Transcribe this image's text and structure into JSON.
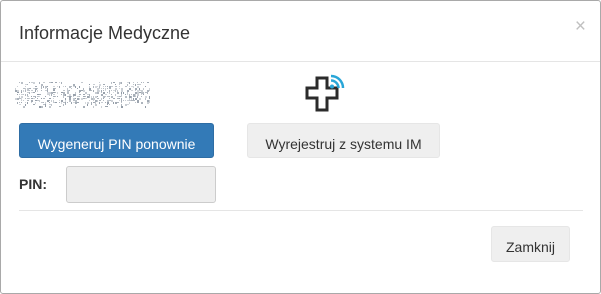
{
  "modal": {
    "title": "Informacje Medyczne",
    "close_symbol": "×"
  },
  "content": {
    "barcode_image": "obfuscated-barcode",
    "logo_icon": "medical-cross-signal-icon",
    "regenerate_pin_label": "Wygeneruj PIN ponownie",
    "unregister_label": "Wyrejestruj z systemu IM",
    "pin_label": "PIN:",
    "pin_value": ""
  },
  "footer": {
    "close_label": "Zamknij"
  },
  "colors": {
    "primary": "#337ab7",
    "default_button": "#efefef",
    "logo_signal": "#29a6d8"
  }
}
